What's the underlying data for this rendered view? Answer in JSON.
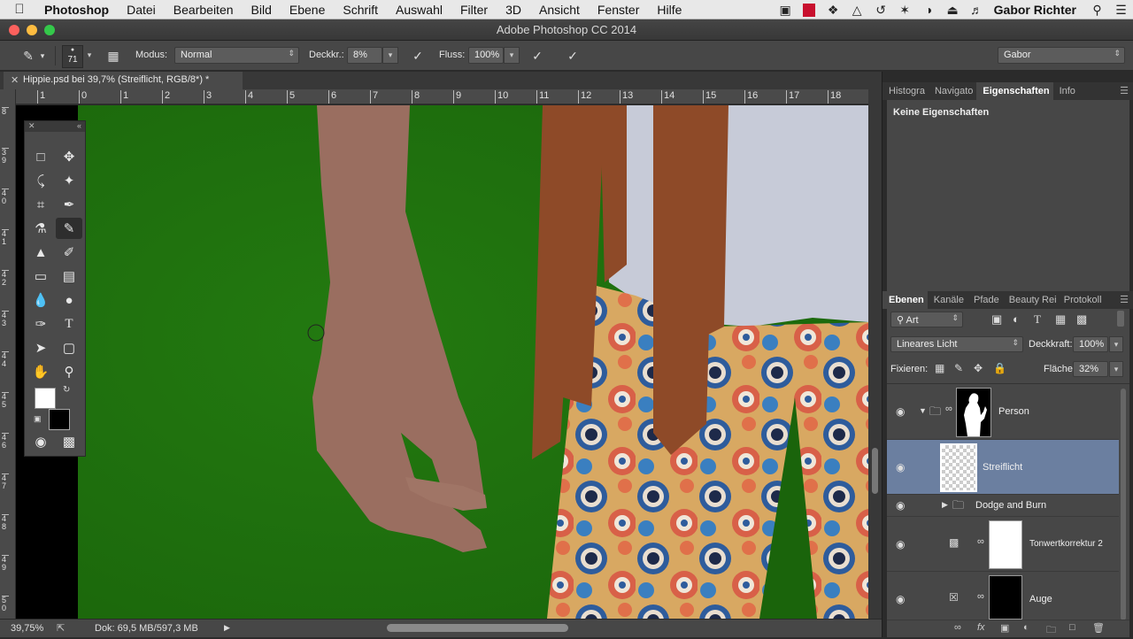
{
  "menubar": {
    "items": [
      "Photoshop",
      "Datei",
      "Bearbeiten",
      "Bild",
      "Ebene",
      "Schrift",
      "Auswahl",
      "Filter",
      "3D",
      "Ansicht",
      "Fenster",
      "Hilfe"
    ],
    "user": "Gabor Richter"
  },
  "window": {
    "title": "Adobe Photoshop CC 2014"
  },
  "options": {
    "brush_size": "71",
    "mode_label": "Modus:",
    "mode_value": "Normal",
    "opacity_label": "Deckkr.:",
    "opacity_value": "8%",
    "flow_label": "Fluss:",
    "flow_value": "100%",
    "workspace": "Gabor"
  },
  "document": {
    "tab_title": "Hippie.psd bei 39,7% (Streiflicht, RGB/8*) *",
    "zoom": "39,75%",
    "doc_info": "Dok: 69,5 MB/597,3 MB"
  },
  "ruler": {
    "h": [
      "1",
      "0",
      "1",
      "2",
      "3",
      "4",
      "5",
      "6",
      "7",
      "8",
      "9",
      "10",
      "11",
      "12",
      "13",
      "14",
      "15",
      "16",
      "17",
      "18"
    ],
    "v": [
      "8",
      "3 9",
      "4 0",
      "4 1",
      "4 2",
      "4 3",
      "4 4",
      "4 5",
      "4 6",
      "4 7",
      "4 8",
      "4 9",
      "5 0"
    ]
  },
  "properties_panel": {
    "tabs": [
      "Histogra",
      "Navigato",
      "Eigenschaften",
      "Info"
    ],
    "active_tab": "Eigenschaften",
    "content": "Keine Eigenschaften"
  },
  "layers_panel": {
    "tabs": [
      "Ebenen",
      "Kanäle",
      "Pfade",
      "Beauty Rei",
      "Protokoll"
    ],
    "active_tab": "Ebenen",
    "filter_label": "Art",
    "blend_mode": "Lineares Licht",
    "opacity_label": "Deckkraft:",
    "opacity_value": "100%",
    "lock_label": "Fixieren:",
    "fill_label": "Fläche:",
    "fill_value": "32%",
    "layers": [
      {
        "name": "Person",
        "type": "group",
        "selected": false
      },
      {
        "name": "Streiflicht",
        "type": "pixel",
        "selected": true
      },
      {
        "name": "Dodge and Burn",
        "type": "group",
        "selected": false
      },
      {
        "name": "Tonwertkorrektur 2",
        "type": "adjustment",
        "selected": false
      },
      {
        "name": "Auge",
        "type": "adjustment",
        "selected": false
      }
    ]
  },
  "colors": {
    "canvas_bg": "#1e6e0c",
    "selected_layer": "#6b7fa0",
    "panel": "#474747"
  }
}
